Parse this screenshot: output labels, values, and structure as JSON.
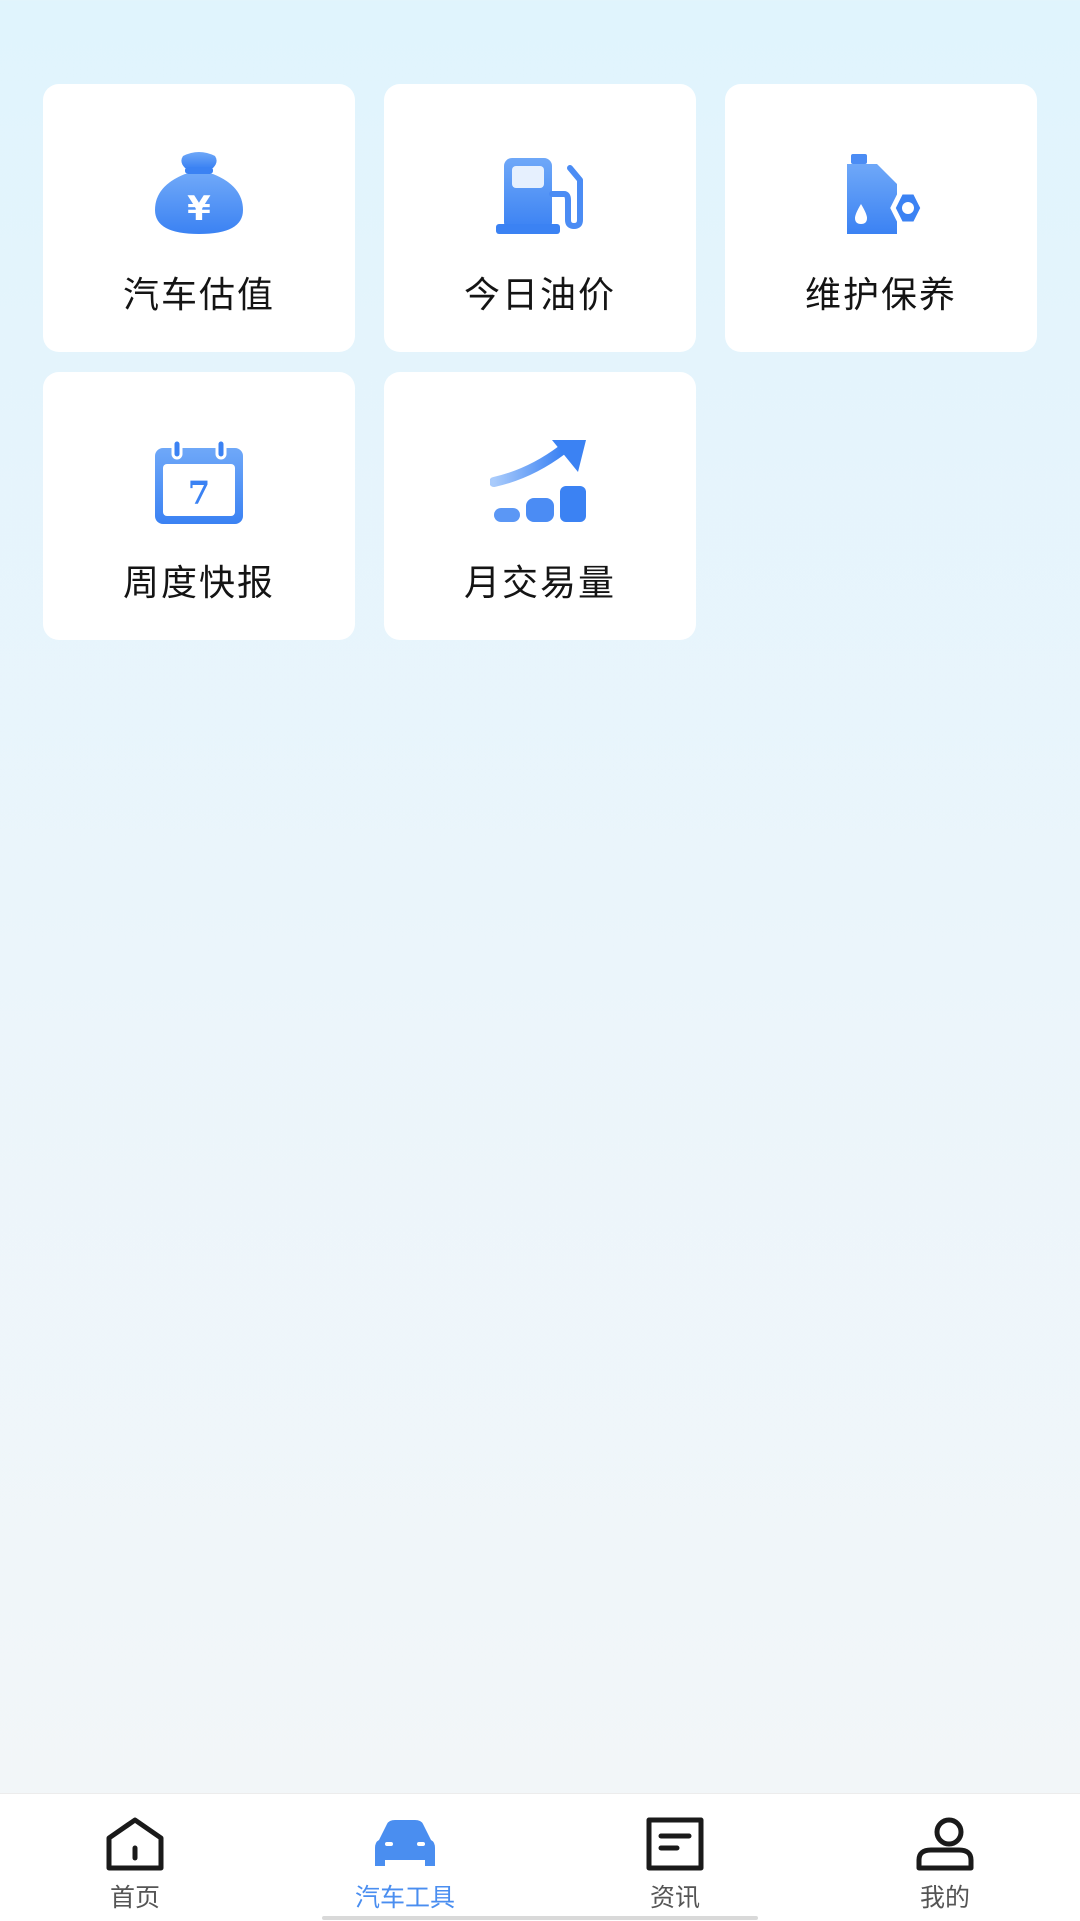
{
  "tools": [
    {
      "label": "汽车估值",
      "icon": "money-bag-icon"
    },
    {
      "label": "今日油价",
      "icon": "fuel-pump-icon"
    },
    {
      "label": "维护保养",
      "icon": "oil-maintenance-icon"
    },
    {
      "label": "周度快报",
      "icon": "calendar-icon",
      "calendar_number": "7"
    },
    {
      "label": "月交易量",
      "icon": "growth-chart-icon"
    }
  ],
  "yuan_symbol": "¥",
  "tabbar": {
    "items": [
      {
        "label": "首页",
        "icon": "home-icon",
        "active": false
      },
      {
        "label": "汽车工具",
        "icon": "car-icon",
        "active": true
      },
      {
        "label": "资讯",
        "icon": "news-icon",
        "active": false
      },
      {
        "label": "我的",
        "icon": "profile-icon",
        "active": false
      }
    ]
  },
  "colors": {
    "accent": "#4a8ef0",
    "icon_blue": "#3f86f4",
    "icon_blue_light": "#7fb2f8",
    "tab_inactive": "#555555",
    "label_text": "#141414"
  }
}
